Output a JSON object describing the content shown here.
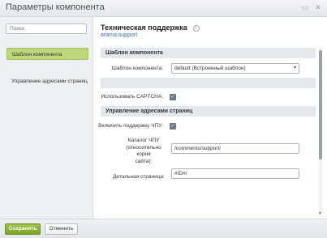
{
  "window": {
    "title": "Параметры компонента",
    "buttons": {
      "maximize_icon": "maximize-icon",
      "close_icon": "close-icon"
    }
  },
  "sidebar": {
    "search_placeholder": "Поиск",
    "items": [
      {
        "label": "Шаблон компонента",
        "active": true
      },
      {
        "label": "Управление адресами страниц",
        "active": false
      }
    ]
  },
  "header": {
    "title": "Техническая поддержка",
    "component_id": "arama:support"
  },
  "sections": {
    "template": {
      "heading": "Шаблон компонента",
      "template_label": "Шаблон компонента:",
      "template_value": "default (Встроенный шаблон)"
    },
    "captcha": {
      "label": "Использовать CAPTCHA:",
      "checked": true
    },
    "urls": {
      "heading": "Управление адресами страниц",
      "sef_label": "Включить поддержку ЧПУ:",
      "sef_checked": true,
      "folder_label_line1": "Каталог ЧПУ",
      "folder_label_line2": "(относительно корня",
      "folder_label_line3": "сайта):",
      "folder_value": "/comments/support/",
      "detail_label": "Детальная страница:",
      "detail_value": "#ID#/"
    }
  },
  "footer": {
    "save_label": "Сохранить",
    "cancel_label": "Отменить"
  },
  "colors": {
    "accent_green": "#8bb23a",
    "active_item": "#bdd87a",
    "link": "#3a6ea5"
  }
}
